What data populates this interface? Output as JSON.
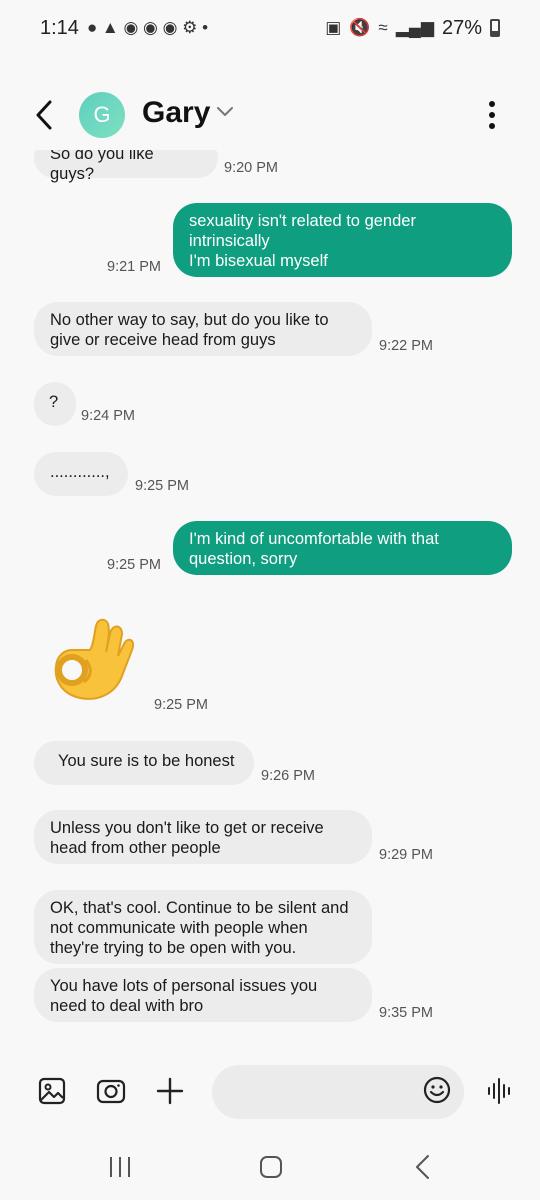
{
  "status_bar": {
    "time": "1:14",
    "battery_percent": "27%"
  },
  "header": {
    "avatar_letter": "G",
    "contact_name": "Gary"
  },
  "messages": [
    {
      "direction": "in",
      "text": "So do you like guys?",
      "time": "9:20 PM"
    },
    {
      "direction": "out",
      "text": "sexuality isn't related to gender intrinsically\nI'm bisexual myself",
      "time": "9:21 PM"
    },
    {
      "direction": "in",
      "text": "No other way to say, but do you like to give or receive head from guys",
      "time": "9:22 PM"
    },
    {
      "direction": "in",
      "text": "?",
      "time": "9:24 PM"
    },
    {
      "direction": "in",
      "text": "............,",
      "time": "9:25 PM"
    },
    {
      "direction": "out",
      "text": "I'm kind of uncomfortable with that question, sorry",
      "time": "9:25 PM"
    },
    {
      "direction": "in",
      "emoji": "ok-hand-emoji",
      "time": "9:25 PM"
    },
    {
      "direction": "in",
      "text": "You sure is to be honest",
      "time": "9:26 PM"
    },
    {
      "direction": "in",
      "text": "Unless you don't like to get or receive head from other people",
      "time": "9:29 PM"
    },
    {
      "direction": "in",
      "text": "OK, that's cool. Continue to be silent and not communicate with people when they're trying to be open with you."
    },
    {
      "direction": "in",
      "text": "You have lots of personal issues you need to deal with bro",
      "time": "9:35 PM"
    }
  ],
  "colors": {
    "outgoing_bubble": "#0f9e80",
    "incoming_bubble": "#ececec",
    "background": "#f8f8f8"
  },
  "composer": {
    "placeholder": ""
  }
}
